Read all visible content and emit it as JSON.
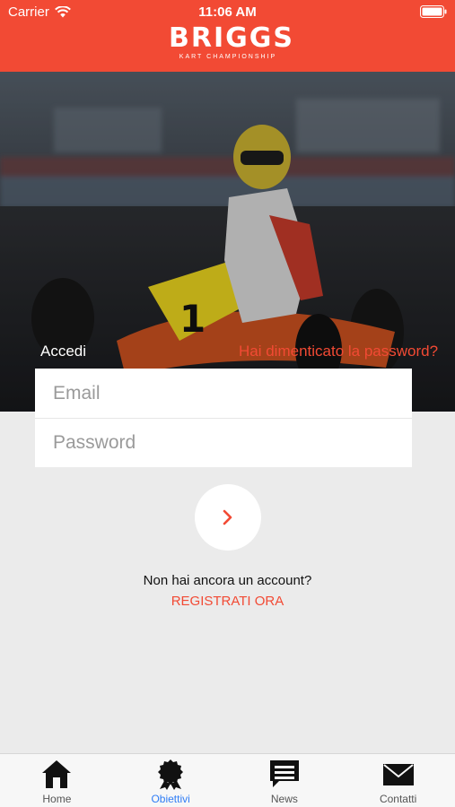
{
  "status_bar": {
    "carrier": "Carrier",
    "time": "11:06 AM"
  },
  "brand": {
    "logo_main": "BRIGGS",
    "logo_sub": "KART CHAMPIONSHIP",
    "color": "#f24a34"
  },
  "login": {
    "title": "Accedi",
    "forgot_password": "Hai dimenticato la password?",
    "email_placeholder": "Email",
    "password_placeholder": "Password"
  },
  "signup": {
    "prompt": "Non hai ancora un account?",
    "link": "REGISTRATI ORA"
  },
  "tabbar": {
    "active_color": "#2f7df6",
    "tabs": [
      {
        "label": "Home",
        "icon": "home-icon"
      },
      {
        "label": "Obiettivi",
        "icon": "badge-icon",
        "active": true
      },
      {
        "label": "News",
        "icon": "news-icon"
      },
      {
        "label": "Contatti",
        "icon": "envelope-icon"
      }
    ]
  }
}
